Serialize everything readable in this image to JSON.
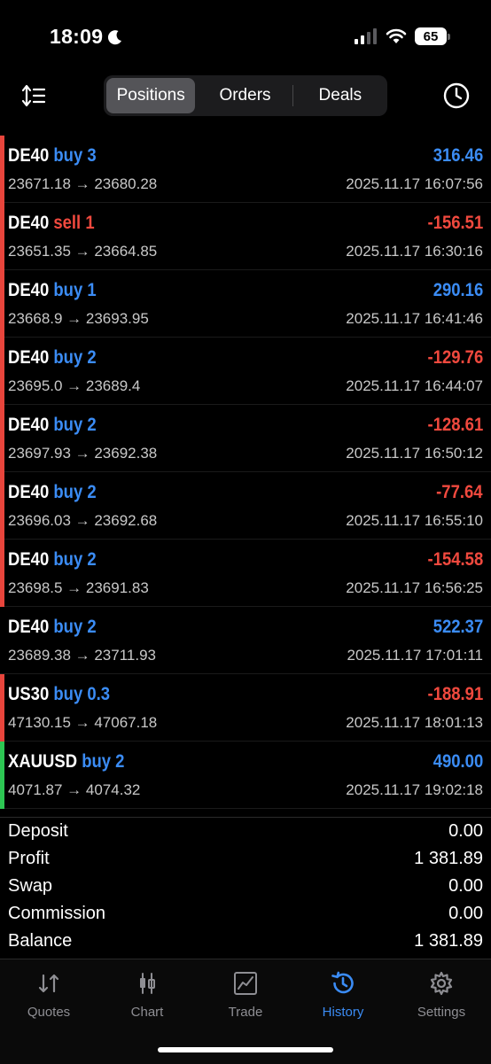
{
  "status": {
    "time": "18:09",
    "battery": "65"
  },
  "tabs_top": {
    "items": [
      {
        "label": "Positions",
        "active": true
      },
      {
        "label": "Orders",
        "active": false
      },
      {
        "label": "Deals",
        "active": false
      }
    ]
  },
  "icons": {
    "sort": "sort-icon",
    "history": "history-clock-icon"
  },
  "colors": {
    "buy": "#3b8cf5",
    "sell": "#f0493e",
    "marker_red": "#e8453c",
    "marker_green": "#2dc653"
  },
  "positions": [
    {
      "symbol": "DE40",
      "side": "buy 3",
      "type": "buy",
      "prices": "23671.18 → 23680.28",
      "profit": "316.46",
      "time": "2025.11.17 16:07:56",
      "marker": "red"
    },
    {
      "symbol": "DE40",
      "side": "sell 1",
      "type": "sell",
      "prices": "23651.35 → 23664.85",
      "profit": "-156.51",
      "time": "2025.11.17 16:30:16",
      "marker": "red"
    },
    {
      "symbol": "DE40",
      "side": "buy 1",
      "type": "buy",
      "prices": "23668.9 → 23693.95",
      "profit": "290.16",
      "time": "2025.11.17 16:41:46",
      "marker": "red"
    },
    {
      "symbol": "DE40",
      "side": "buy 2",
      "type": "buy",
      "prices": "23695.0 → 23689.4",
      "profit": "-129.76",
      "time": "2025.11.17 16:44:07",
      "marker": "red"
    },
    {
      "symbol": "DE40",
      "side": "buy 2",
      "type": "buy",
      "prices": "23697.93 → 23692.38",
      "profit": "-128.61",
      "time": "2025.11.17 16:50:12",
      "marker": "red"
    },
    {
      "symbol": "DE40",
      "side": "buy 2",
      "type": "buy",
      "prices": "23696.03 → 23692.68",
      "profit": "-77.64",
      "time": "2025.11.17 16:55:10",
      "marker": "red"
    },
    {
      "symbol": "DE40",
      "side": "buy 2",
      "type": "buy",
      "prices": "23698.5 → 23691.83",
      "profit": "-154.58",
      "time": "2025.11.17 16:56:25",
      "marker": "red"
    },
    {
      "symbol": "DE40",
      "side": "buy 2",
      "type": "buy",
      "prices": "23689.38 → 23711.93",
      "profit": "522.37",
      "time": "2025.11.17 17:01:11",
      "marker": "none"
    },
    {
      "symbol": "US30",
      "side": "buy 0.3",
      "type": "buy",
      "prices": "47130.15 → 47067.18",
      "profit": "-188.91",
      "time": "2025.11.17 18:01:13",
      "marker": "red"
    },
    {
      "symbol": "XAUUSD",
      "side": "buy 2",
      "type": "buy",
      "prices": "4071.87 → 4074.32",
      "profit": "490.00",
      "time": "2025.11.17 19:02:18",
      "marker": "green"
    }
  ],
  "summary": [
    {
      "label": "Deposit",
      "value": "0.00"
    },
    {
      "label": "Profit",
      "value": "1 381.89"
    },
    {
      "label": "Swap",
      "value": "0.00"
    },
    {
      "label": "Commission",
      "value": "0.00"
    },
    {
      "label": "Balance",
      "value": "1 381.89"
    }
  ],
  "tabbar": [
    {
      "label": "Quotes",
      "icon": "quotes-icon",
      "active": false
    },
    {
      "label": "Chart",
      "icon": "chart-candles-icon",
      "active": false
    },
    {
      "label": "Trade",
      "icon": "trade-icon",
      "active": false
    },
    {
      "label": "History",
      "icon": "history-icon",
      "active": true
    },
    {
      "label": "Settings",
      "icon": "settings-gear-icon",
      "active": false
    }
  ]
}
